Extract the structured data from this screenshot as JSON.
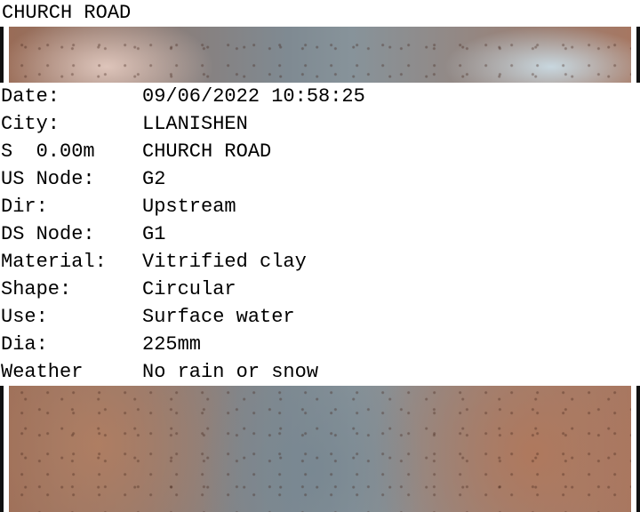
{
  "caption": "CHURCH ROAD",
  "info": {
    "rows": [
      {
        "label": "Date:",
        "value": "09/06/2022 10:58:25"
      },
      {
        "label": "City:",
        "value": "LLANISHEN"
      },
      {
        "label": "S  0.00m",
        "value": "CHURCH ROAD"
      },
      {
        "label": "US Node:",
        "value": "G2"
      },
      {
        "label": "Dir:",
        "value": "Upstream"
      },
      {
        "label": "DS Node:",
        "value": "G1"
      },
      {
        "label": "Material:",
        "value": "Vitrified clay"
      },
      {
        "label": "Shape:",
        "value": "Circular"
      },
      {
        "label": "Use:",
        "value": "Surface water"
      },
      {
        "label": "Dia:",
        "value": "225mm"
      },
      {
        "label": "Weather",
        "value": "No rain or snow"
      }
    ]
  }
}
